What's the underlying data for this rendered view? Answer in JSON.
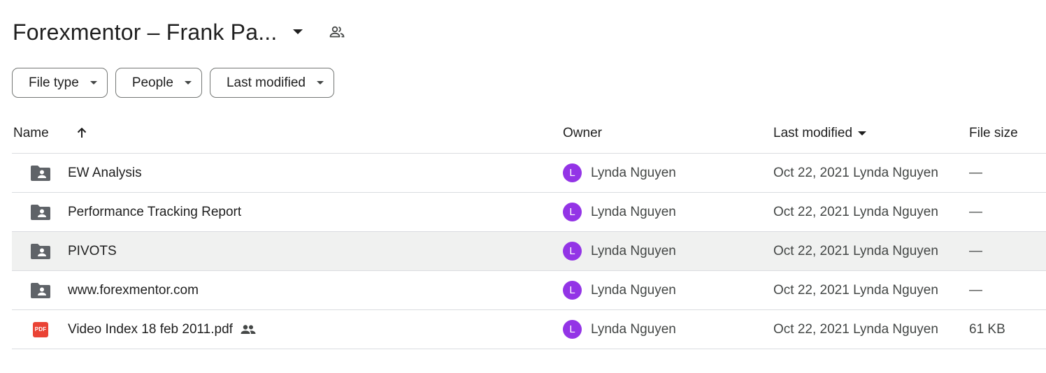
{
  "header": {
    "title": "Forexmentor – Frank Pa...",
    "dropdown_icon": "arrow-drop-down-icon",
    "shared_icon": "people-outline-icon"
  },
  "filters": [
    {
      "label": "File type"
    },
    {
      "label": "People"
    },
    {
      "label": "Last modified"
    }
  ],
  "table": {
    "columns": {
      "name": "Name",
      "owner": "Owner",
      "last_modified": "Last modified",
      "file_size": "File size"
    },
    "sort": {
      "column": "Name",
      "direction": "ascending",
      "icon": "arrow-upward-icon"
    },
    "rows": [
      {
        "name": "EW Analysis",
        "type": "shared-folder",
        "shared": false,
        "owner": "Lynda Nguyen",
        "owner_initial": "L",
        "modified": "Oct 22, 2021 Lynda Nguyen",
        "size": "—"
      },
      {
        "name": "Performance Tracking Report",
        "type": "shared-folder",
        "shared": false,
        "owner": "Lynda Nguyen",
        "owner_initial": "L",
        "modified": "Oct 22, 2021 Lynda Nguyen",
        "size": "—"
      },
      {
        "name": "PIVOTS",
        "type": "shared-folder",
        "shared": false,
        "owner": "Lynda Nguyen",
        "owner_initial": "L",
        "modified": "Oct 22, 2021 Lynda Nguyen",
        "size": "—",
        "highlighted": true
      },
      {
        "name": "www.forexmentor.com",
        "type": "shared-folder",
        "shared": false,
        "owner": "Lynda Nguyen",
        "owner_initial": "L",
        "modified": "Oct 22, 2021 Lynda Nguyen",
        "size": "—"
      },
      {
        "name": "Video Index 18 feb 2011.pdf",
        "type": "pdf",
        "shared": true,
        "owner": "Lynda Nguyen",
        "owner_initial": "L",
        "modified": "Oct 22, 2021 Lynda Nguyen",
        "size": "61 KB",
        "badge": "PDF"
      }
    ]
  },
  "colors": {
    "avatar": "#9334e6",
    "pdf": "#ea4335",
    "folder": "#5f6368",
    "row_highlight": "#f0f1f0"
  }
}
